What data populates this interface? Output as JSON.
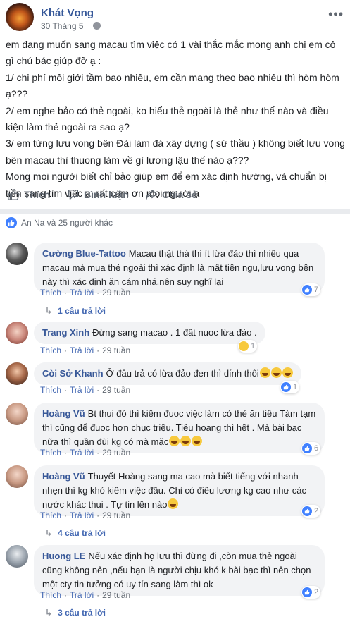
{
  "post": {
    "author": "Khát Vọng",
    "date": "30 Tháng 5",
    "paragraphs": [
      "em đang muốn sang macau tìm việc có 1 vài thắc mắc mong anh chị em cô gì chú bác giúp đỡ ạ :",
      "1/ chi phí môi giới tầm bao nhiêu, em cần mang theo bao nhiêu thì hòm hòm ạ???",
      "2/ em nghe bảo có thẻ ngoài, ko hiểu thẻ ngoài là thẻ như thế nào và điều kiện làm thẻ ngoài ra sao ạ?",
      "3/ em từng lưu vong bên Đài làm đá xây dựng ( sứ thầu ) không biết lưu vong bên macau thì thuong làm về gì lương lậu thế nào ạ???",
      "Mong mọi người biết chỉ bảo giúp em để em xác định hướng, và chuẩn bị tiền sang tìm việc ạ, rất cám ơn mọi người ạ"
    ],
    "actions": {
      "like": "Thích",
      "comment": "Bình luận",
      "share": "Chia sẻ"
    },
    "reactions_text": "An Na và 25 người khác"
  },
  "colors": {
    "link_blue": "#385898",
    "like_blue": "#4080ff",
    "bubble": "#f2f3f5"
  },
  "comments": [
    {
      "name": "Cường Blue-Tattoo",
      "text": "Macau thật thà thì ít lừa đảo thì nhiều qua macau mà mua thẻ ngoài thì xác định là mất tiền ngu,lưu vong bên này thì xác định ăn cám nhá.nên suy nghĩ lại",
      "like": "Thích",
      "reply": "Trả lời",
      "time": "29 tuần",
      "reaction_count": "7",
      "reaction_type": "like",
      "replies": "1 câu trả lời"
    },
    {
      "name": "Trang Xinh",
      "text": "Đừng sang macao . 1 đất nuoc lừa đảo .",
      "like": "Thích",
      "reply": "Trả lời",
      "time": "29 tuần",
      "reaction_count": "1",
      "reaction_type": "haha",
      "replies": ""
    },
    {
      "name": "Còi Sở Khanh",
      "text": "Ở đâu trả có lừa đảo đen thì dính thôi",
      "like": "Thích",
      "reply": "Trả lời",
      "time": "29 tuần",
      "reaction_count": "1",
      "reaction_type": "like",
      "replies": ""
    },
    {
      "name": "Hoàng Vũ",
      "text": "Bt thui đó thì kiếm đuoc việc làm có thẻ ăn tiêu Tàm tạm thì cũng để đuoc hơn chục triệu. Tiêu hoang thì hết . Mà bài bạc nữa thì quần đùi kg có mà mặc",
      "like": "Thích",
      "reply": "Trả lời",
      "time": "29 tuần",
      "reaction_count": "6",
      "reaction_type": "like",
      "replies": ""
    },
    {
      "name": "Hoàng Vũ",
      "text": "Thuyết Hoàng sang ma cao mà biết tiếng với nhanh nhẹn thì kg khó kiếm việc đâu. Chỉ có điều lương kg cao như các nước khác thui . Tự tin lên nào",
      "like": "Thích",
      "reply": "Trả lời",
      "time": "29 tuần",
      "reaction_count": "2",
      "reaction_type": "like",
      "replies": "4 câu trả lời"
    },
    {
      "name": "Huong LE",
      "text": "Nếu xác định họ lưu thì đừng đi ,còn mua thẻ ngoài cũng không nên ,nếu bạn là người chịu khó k bài bạc thì nên chọn một cty tin tưởng có uy tín sang làm thì ok",
      "like": "Thích",
      "reply": "Trả lời",
      "time": "29 tuần",
      "reaction_count": "2",
      "reaction_type": "like",
      "replies": "3 câu trả lời"
    }
  ]
}
